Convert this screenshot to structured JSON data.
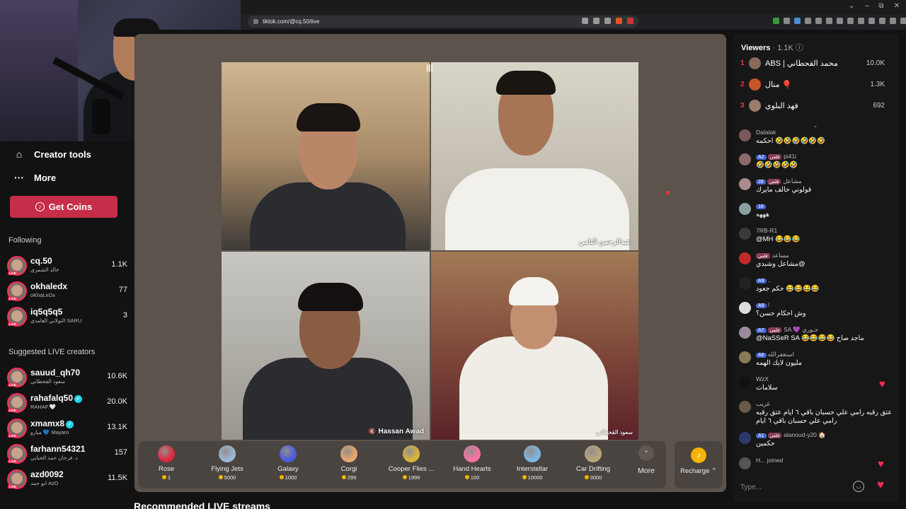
{
  "browser": {
    "url": "tiktok.com/@cq.50/live",
    "window_controls": [
      "⌄",
      "–",
      "⧉",
      "✕"
    ]
  },
  "sidebar": {
    "creator_tools": "Creator tools",
    "more": "More",
    "get_coins": "Get Coins",
    "following_heading": "Following",
    "following": [
      {
        "name": "cq.50",
        "sub": "خالد الشمري",
        "count": "1.1K"
      },
      {
        "name": "okhaledx",
        "sub": "oKhaLeDx",
        "count": "77"
      },
      {
        "name": "iq5q5q5",
        "sub": "التولابي الغامدي SARU",
        "count": "3"
      }
    ],
    "suggested_heading": "Suggested LIVE creators",
    "suggested": [
      {
        "name": "sauud_qh70",
        "sub": "سعود القحطاني",
        "count": "10.6K",
        "verified": false
      },
      {
        "name": "rahafalq50",
        "sub": "RAHAF.🤍",
        "count": "20.0K",
        "verified": true
      },
      {
        "name": "xmamx8",
        "sub": "ميارو 💙 Mayaro",
        "count": "13.1K",
        "verified": true
      },
      {
        "name": "farhann54321",
        "sub": "د. فرحان حمد الحبابي",
        "count": "157",
        "verified": false
      },
      {
        "name": "azd0092",
        "sub": "ابو حمد AzD",
        "count": "11.5K",
        "verified": false
      }
    ],
    "live_tag": "LIVE"
  },
  "stream": {
    "tile2_name": "عبدالرحمن النامي.",
    "tile3_name": "Hassan Awad",
    "tile4_name": "سعود القحطاني"
  },
  "gifts": [
    {
      "name": "Rose",
      "price": "1",
      "color": "#e0263f"
    },
    {
      "name": "Flying Jets",
      "price": "5000",
      "color": "#9bb6d6"
    },
    {
      "name": "Galaxy",
      "price": "1000",
      "color": "#4a5be0"
    },
    {
      "name": "Corgi",
      "price": "299",
      "color": "#e8a76b"
    },
    {
      "name": "Cooper Flies ...",
      "price": "1999",
      "color": "#d9b43c"
    },
    {
      "name": "Hand Hearts",
      "price": "100",
      "color": "#ff6fa6"
    },
    {
      "name": "Interstellar",
      "price": "10000",
      "color": "#7ab8e6"
    },
    {
      "name": "Car Drifting",
      "price": "3000",
      "color": "#b8a57a"
    }
  ],
  "gift_more": "More",
  "recharge": "Recharge",
  "recommended": "Recommended LIVE streams",
  "viewers": {
    "label": "Viewers",
    "count": "1.1K",
    "top": [
      {
        "rank": "1",
        "name": "ABS | محمد القحطاني",
        "count": "10.0K",
        "color": "#8a6a5a"
      },
      {
        "rank": "2",
        "name": "منال 🎈",
        "count": "1.3K",
        "color": "#c8542a"
      },
      {
        "rank": "3",
        "name": "فهد البلوي",
        "count": "692",
        "color": "#9a7c6a"
      }
    ]
  },
  "chat": [
    {
      "line1": "Dalalak",
      "line2": "احكمه 🤣🤣🤣🤣🤣🤣",
      "level": "",
      "badge": "",
      "color": "#7a5a5a"
    },
    {
      "line1": "pi41i",
      "line2": "🤣🤣🤣🤣🤣",
      "level": "A2",
      "badge": "فلس",
      "color": "#8a6a6a"
    },
    {
      "line1": "مشاعل",
      "line2": "قولوني حالف مايرك",
      "level": "28",
      "badge": "فلس",
      "color": "#aa8a8a"
    },
    {
      "line1": "",
      "line2": "هههه",
      "level": "16",
      "badge": "",
      "color": "#8aa0a0"
    },
    {
      "line1": "7RB-R1",
      "line2": "@MH 😂😂😂",
      "level": "",
      "badge": "",
      "color": "#3a3a3a"
    },
    {
      "line1": "مساعد",
      "line2": "مشاعل وشبدي@",
      "level": "",
      "badge": "فلس",
      "color": "#c02a2a"
    },
    {
      "line1": "..",
      "line2": "حكم جعود 😂😂😂😂",
      "level": "A9",
      "badge": "",
      "color": "#222"
    },
    {
      "line1": "/",
      "line2": "وش احكام حسن؟",
      "level": "A9",
      "badge": "",
      "color": "#ddd"
    },
    {
      "line1": "SA 💜 جـوري",
      "line2": "@NaSSeR SA 😂😂😂😂 ماجد صاح",
      "level": "A7",
      "badge": "فلس",
      "color": "#9a8a9a"
    },
    {
      "line1": "استغفرالله",
      "line2": "مليون لايك الهمه",
      "level": "A6",
      "badge": "",
      "color": "#8a7a5a"
    },
    {
      "line1": "WzX",
      "line2": "سلامات",
      "level": "",
      "badge": "",
      "color": "#111"
    },
    {
      "line1": "غريب",
      "line2": "عتق رقبه رامي علي حسبان باقي ٦ ايام عتق رقبه",
      "line3": "رامي علي حسبان باقي ٦ ايام",
      "level": "",
      "badge": "",
      "color": "#6a5a4a"
    },
    {
      "line1": "alanoud-y20 🏠",
      "line2": "حكمين",
      "level": "A1",
      "badge": "فلس",
      "color": "#2a3a6a"
    },
    {
      "line1": "H... joined",
      "line2": "",
      "level": "",
      "badge": "",
      "color": "#555"
    }
  ],
  "chat_placeholder": "Type...",
  "colors": {
    "accent": "#fe2c55",
    "coins": "#f5b400"
  }
}
